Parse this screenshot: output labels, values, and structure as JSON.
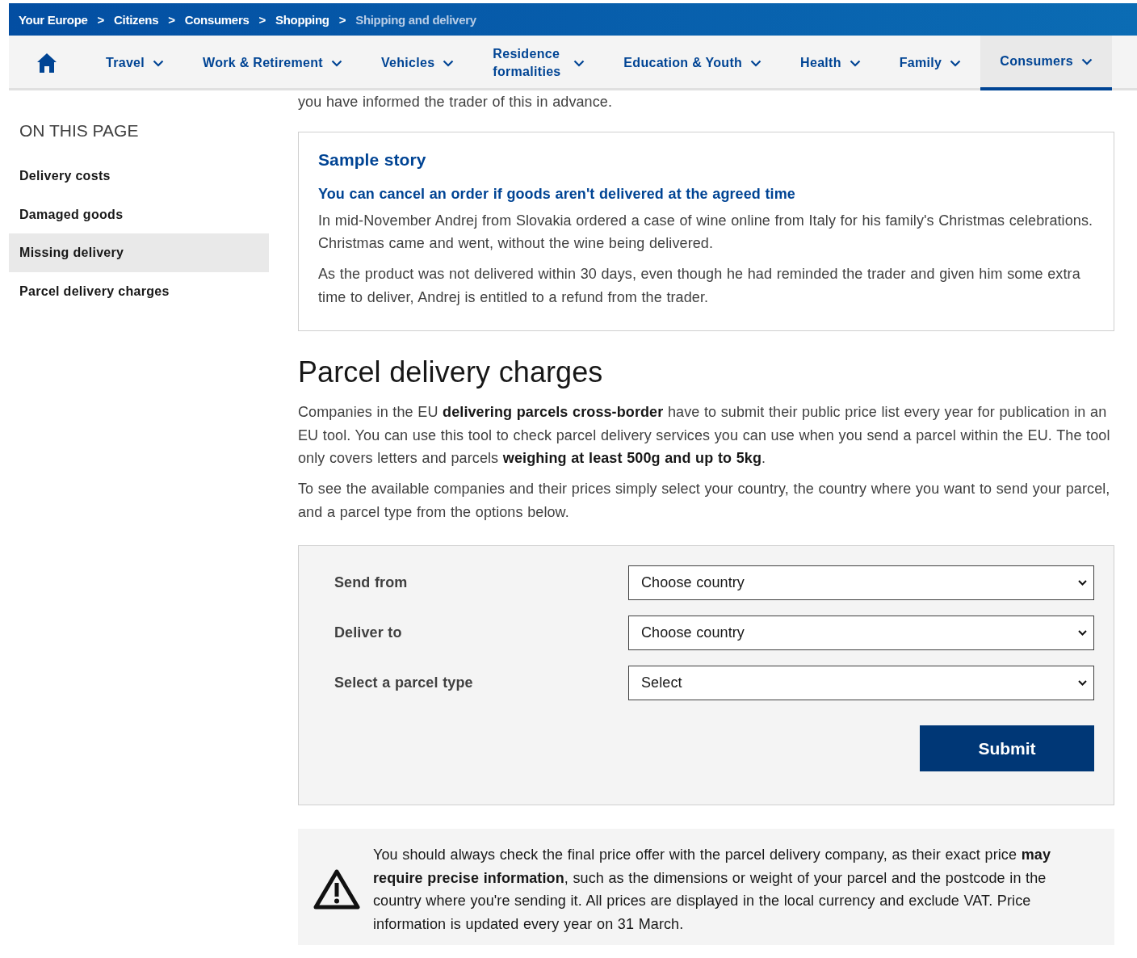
{
  "breadcrumb": [
    {
      "label": "Your Europe",
      "current": false
    },
    {
      "label": "Citizens",
      "current": false
    },
    {
      "label": "Consumers",
      "current": false
    },
    {
      "label": "Shopping",
      "current": false
    },
    {
      "label": "Shipping and delivery",
      "current": true
    }
  ],
  "breadcrumb_separator": ">",
  "nav": [
    {
      "kind": "home",
      "selected": false
    },
    {
      "kind": "menu",
      "label": "Travel",
      "selected": false
    },
    {
      "kind": "menu",
      "label": "Work & Retirement",
      "selected": false
    },
    {
      "kind": "menu",
      "label": "Vehicles",
      "selected": false
    },
    {
      "kind": "menu",
      "label": "Residence formalities",
      "selected": false
    },
    {
      "kind": "menu",
      "label": "Education & Youth",
      "selected": false
    },
    {
      "kind": "menu",
      "label": "Health",
      "selected": false
    },
    {
      "kind": "menu",
      "label": "Family",
      "selected": false
    },
    {
      "kind": "menu",
      "label": "Consumers",
      "selected": true
    }
  ],
  "sidebar": {
    "title": "ON THIS PAGE",
    "items": [
      {
        "label": "Delivery costs",
        "selected": false
      },
      {
        "label": "Damaged goods",
        "selected": false
      },
      {
        "label": "Missing delivery",
        "selected": true
      },
      {
        "label": "Parcel delivery charges",
        "selected": false
      }
    ]
  },
  "intro_text": "you have informed the trader of this in advance.",
  "sample_story": {
    "title": "Sample story",
    "subtitle": "You can cancel an order if goods aren't delivered at the agreed time",
    "paragraphs": [
      "In mid-November Andrej from Slovakia ordered a case of wine online from Italy for his family's Christmas celebrations. Christmas came and went, without the wine being delivered.",
      "As the product was not delivered within 30 days, even though he had reminded the trader and given him some extra time to deliver, Andrej is entitled to a refund from the trader."
    ]
  },
  "section": {
    "heading": "Parcel delivery charges",
    "paragraphs": [
      "Companies in the EU **delivering parcels cross-border** have to submit their public price list every year for publication in an EU tool. You can use this tool to check parcel delivery services you can use when you send a parcel within the EU. The tool only covers letters and parcels **weighing at least 500g and up to 5kg**.",
      "To see the available companies and their prices simply select your country, the country where you want to send your parcel, and a parcel type from the options below."
    ]
  },
  "form": {
    "fields": [
      {
        "label": "Send from",
        "value": "Choose country"
      },
      {
        "label": "Deliver to",
        "value": "Choose country"
      },
      {
        "label": "Select a parcel type",
        "value": "Select"
      }
    ],
    "submit": "Submit"
  },
  "notice": {
    "text": "You should always check the final price offer with the parcel delivery company, as their exact price **may require precise information**, such as the dimensions or weight of your parcel and the postcode in the country where you're sending it. All prices are displayed in the local currency and exclude VAT. Price information is updated every year on 31 March."
  }
}
